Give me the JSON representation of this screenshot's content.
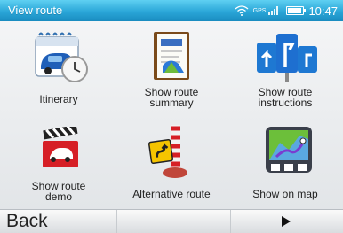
{
  "statusbar": {
    "title": "View route",
    "gps_label": "GPS",
    "signal_label": "...ll",
    "time": "10:47",
    "wifi_icon": "wifi-icon",
    "battery_icon": "battery-icon"
  },
  "tiles": [
    {
      "label_lines": [
        "Itinerary"
      ],
      "icon": "itinerary-calendar-car-clock-icon"
    },
    {
      "label_lines": [
        "Show route",
        "summary"
      ],
      "icon": "route-summary-book-icon"
    },
    {
      "label_lines": [
        "Show route",
        "instructions"
      ],
      "icon": "route-instructions-signs-icon"
    },
    {
      "label_lines": [
        "Show route",
        "demo"
      ],
      "icon": "route-demo-clapperboard-icon"
    },
    {
      "label_lines": [
        "Alternative route"
      ],
      "icon": "alternative-route-sign-icon"
    },
    {
      "label_lines": [
        "Show on map"
      ],
      "icon": "show-on-map-icon"
    }
  ],
  "bottombar": {
    "back_label": "Back",
    "next_icon": "play-right-arrow-icon"
  },
  "colors": {
    "status_bar": "#2aa6d8",
    "background": "#eceef0",
    "text": "#222222"
  }
}
